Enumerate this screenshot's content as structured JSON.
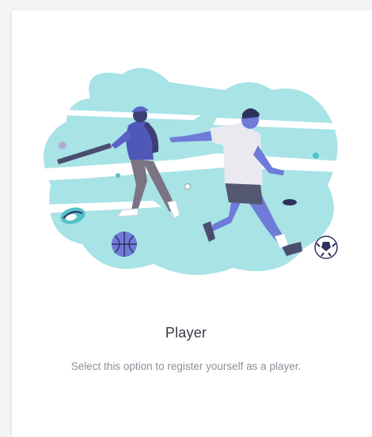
{
  "option": {
    "title": "Player",
    "description": "Select this option to register yourself as a player.",
    "illustration": "sports-players-illustration"
  },
  "colors": {
    "card_background": "#ffffff",
    "page_background": "#f2f3f5",
    "cloud": "#a8e3e6",
    "accent": "#6c63ff",
    "player_purple": "#6f7bd8",
    "skin": "#5b62c4",
    "title_text": "#333845",
    "description_text": "#8b8f98"
  }
}
